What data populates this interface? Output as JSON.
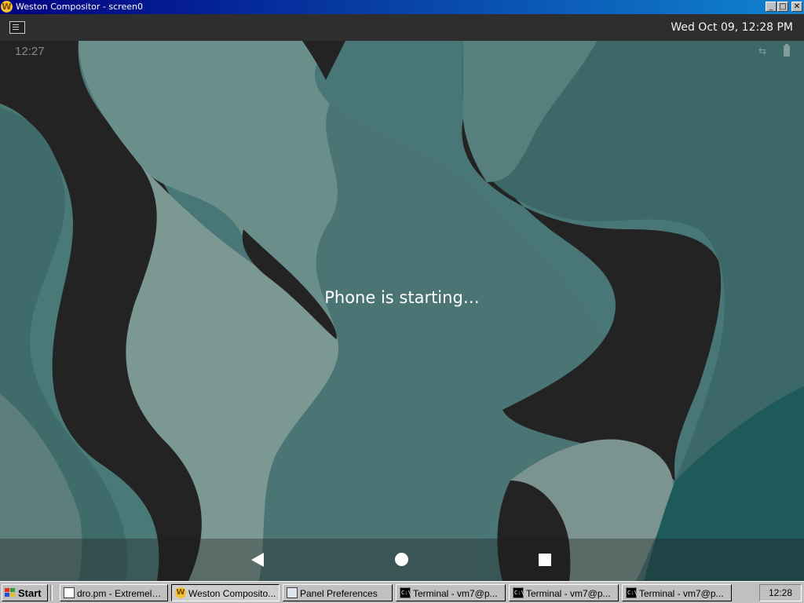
{
  "window": {
    "title": "Weston Compositor - screen0",
    "icon": "weston-icon",
    "controls": {
      "minimize": "_",
      "maximize": "□",
      "close": "✕"
    }
  },
  "weston_panel": {
    "launcher_icon": "terminal-launcher-icon",
    "clock": "Wed Oct 09, 12:28 PM"
  },
  "android": {
    "status_time": "12:27",
    "status_icons": [
      "data-arrows-icon",
      "battery-icon"
    ],
    "message": "Phone is starting…",
    "nav": [
      "back-icon",
      "home-icon",
      "recents-icon"
    ]
  },
  "taskbar": {
    "start_label": "Start",
    "tasks": [
      {
        "label": "dro.pm - Extremely ...",
        "icon": "document-icon",
        "active": false
      },
      {
        "label": "Weston Composito...",
        "icon": "weston-icon",
        "active": true
      },
      {
        "label": "Panel Preferences",
        "icon": "preferences-icon",
        "active": false
      },
      {
        "label": "Terminal - vm7@p...",
        "icon": "terminal-icon",
        "active": false
      },
      {
        "label": "Terminal - vm7@p...",
        "icon": "terminal-icon",
        "active": false
      },
      {
        "label": "Terminal - vm7@p...",
        "icon": "terminal-icon",
        "active": false
      }
    ],
    "tray_clock": "12:28"
  },
  "colors": {
    "title_bar": "#000080",
    "android_teal": "#3d6b6c",
    "dark_shape": "#222222",
    "taskbar": "#c0c0c0"
  }
}
